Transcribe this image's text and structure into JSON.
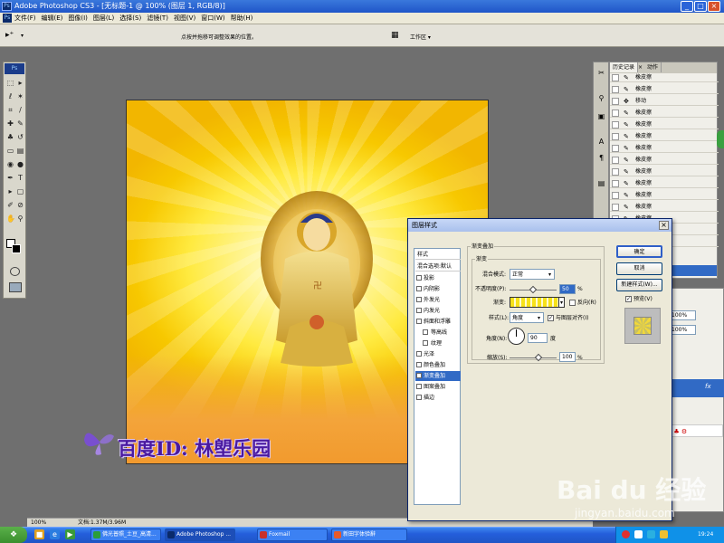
{
  "titlebar": {
    "title": "Adobe Photoshop CS3 - [无标题-1 @ 100% (图层 1, RGB/8)]",
    "logo": "Ps"
  },
  "menubar": {
    "items": [
      "文件(F)",
      "编辑(E)",
      "图像(I)",
      "图层(L)",
      "选择(S)",
      "滤镜(T)",
      "视图(V)",
      "窗口(W)",
      "帮助(H)"
    ]
  },
  "optbar": {
    "hint": "点按并拖移可调整效果的位置。",
    "workspace_label": "工作区 ▾"
  },
  "toolbox": {
    "logo": "Ps"
  },
  "watermark": {
    "text": "百度ID: 林塱乐园"
  },
  "status": {
    "zoom": "100%",
    "doc": "文档:1.37M/3.96M"
  },
  "history": {
    "tabs": [
      "历史记录",
      "动作"
    ],
    "rows": [
      {
        "icon": "eraser-icon",
        "label": "橡皮擦"
      },
      {
        "icon": "eraser-icon",
        "label": "橡皮擦"
      },
      {
        "icon": "move-icon",
        "label": "移动"
      },
      {
        "icon": "eraser-icon",
        "label": "橡皮擦"
      },
      {
        "icon": "eraser-icon",
        "label": "橡皮擦"
      },
      {
        "icon": "eraser-icon",
        "label": "橡皮擦"
      },
      {
        "icon": "eraser-icon",
        "label": "橡皮擦"
      },
      {
        "icon": "eraser-icon",
        "label": "橡皮擦"
      },
      {
        "icon": "eraser-icon",
        "label": "橡皮擦"
      },
      {
        "icon": "eraser-icon",
        "label": "橡皮擦"
      },
      {
        "icon": "eraser-icon",
        "label": "橡皮擦"
      },
      {
        "icon": "eraser-icon",
        "label": "橡皮擦"
      },
      {
        "icon": "eraser-icon",
        "label": "橡皮擦"
      },
      {
        "icon": "eraser-icon",
        "label": "橡皮擦"
      },
      {
        "icon": "eraser-icon",
        "label": "橡皮擦"
      }
    ]
  },
  "layers": {
    "opacity": "100%",
    "fill": "100%",
    "fx": "fx"
  },
  "dialog": {
    "title": "图层样式",
    "close": "×",
    "styles": [
      {
        "label": "样式",
        "type": "hdr"
      },
      {
        "label": "混合选项:默认",
        "type": "hdr"
      },
      {
        "label": "投影",
        "checked": ""
      },
      {
        "label": "内阴影",
        "checked": ""
      },
      {
        "label": "外发光",
        "checked": ""
      },
      {
        "label": "内发光",
        "checked": ""
      },
      {
        "label": "斜面和浮雕",
        "checked": ""
      },
      {
        "label": "等高线",
        "checked": "",
        "type": "sub"
      },
      {
        "label": "纹理",
        "checked": "",
        "type": "sub"
      },
      {
        "label": "光泽",
        "checked": ""
      },
      {
        "label": "颜色叠加",
        "checked": ""
      },
      {
        "label": "渐变叠加",
        "checked": "✓",
        "type": "sel"
      },
      {
        "label": "图案叠加",
        "checked": ""
      },
      {
        "label": "描边",
        "checked": ""
      }
    ],
    "section_title": "渐变叠加",
    "group_title": "渐变",
    "blend_mode_label": "混合模式:",
    "blend_mode_value": "正常",
    "opacity_label": "不透明度(P):",
    "opacity_value": "50",
    "opacity_unit": "%",
    "gradient_label": "渐变:",
    "reverse_label": "反向(R)",
    "style_label": "样式(L):",
    "style_value": "角度",
    "align_label": "与图层对齐(I)",
    "angle_label": "角度(N):",
    "angle_value": "90",
    "angle_unit": "度",
    "scale_label": "缩放(S):",
    "scale_value": "100",
    "scale_unit": "%",
    "ok": "确定",
    "cancel": "取消",
    "new_style": "新建样式(W)...",
    "preview_label": "预览(V)"
  },
  "taskbar": {
    "start": "开始",
    "tasks": [
      {
        "label": "佛光普照_土豆_高清...",
        "color": "#2a9d3a"
      },
      {
        "label": "Adobe Photoshop ...",
        "color": "#0a2a6a",
        "active": true
      },
      {
        "label": "Foxmail",
        "color": "#c8302a"
      },
      {
        "label": "新田字体验辭",
        "color": "#e85a2a"
      }
    ],
    "time": "19:24"
  },
  "baidu": {
    "brand": "Bai du 经验",
    "url": "jingyan.baidu.com"
  },
  "colors": {
    "accent": "#316ac5",
    "canvas_yellow": "#f7c800",
    "watermark_purple": "#4a1aa0"
  }
}
